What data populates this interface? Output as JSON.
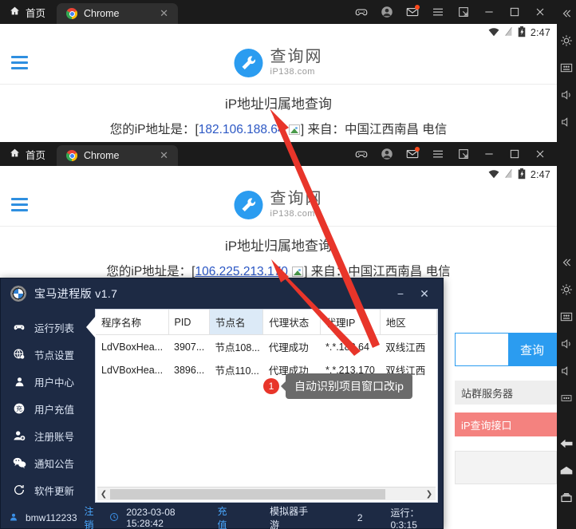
{
  "emulator": {
    "titlebar": {
      "home_label": "首页",
      "tab_label": "Chrome",
      "close_glyph": "✕",
      "icons": [
        "gamepad-icon",
        "account-icon",
        "mail-icon",
        "menu-icon",
        "resize-icon",
        "minimize-icon",
        "maximize-icon",
        "close-icon"
      ]
    },
    "statusbar": {
      "time": "2:47",
      "icons": [
        "wifi-icon",
        "signal-icon",
        "battery-icon"
      ]
    },
    "rail_icons": [
      "collapse-icon",
      "settings-icon",
      "keyboard-icon",
      "volume-up-icon",
      "volume-down-icon",
      "more-icon",
      "back-icon",
      "home-icon",
      "recents-icon"
    ]
  },
  "site": {
    "brand_cn": "查询网",
    "brand_en": "iP138.com",
    "page_title": "iP地址归属地查询",
    "ip_prefix": "您的iP地址是：[",
    "ip_suffix": "] 来自：",
    "location": "中国江西南昌 电信"
  },
  "windows": [
    {
      "ip": "182.106.188.64",
      "hovered": false
    },
    {
      "ip": "106.225.213.170",
      "hovered": true
    }
  ],
  "side_widgets": {
    "query_value": "",
    "query_placeholder": "",
    "query_button": "查询",
    "links": [
      {
        "label": "站群服务器",
        "hot": false
      },
      {
        "label": "iP查询接口",
        "hot": true
      }
    ]
  },
  "dialog": {
    "title": "宝马进程版 v1.7",
    "minimize_glyph": "−",
    "close_glyph": "✕",
    "nav": [
      {
        "label": "运行列表",
        "icon": "gamepad-icon",
        "active": true
      },
      {
        "label": "节点设置",
        "icon": "globe-icon",
        "active": false
      },
      {
        "label": "用户中心",
        "icon": "user-icon",
        "active": false
      },
      {
        "label": "用户充值",
        "icon": "recharge-icon",
        "active": false
      },
      {
        "label": "注册账号",
        "icon": "user-add-icon",
        "active": false
      },
      {
        "label": "通知公告",
        "icon": "wechat-icon",
        "active": false
      },
      {
        "label": "软件更新",
        "icon": "refresh-icon",
        "active": false
      }
    ],
    "table": {
      "columns": [
        {
          "label": "程序名称",
          "selected": false
        },
        {
          "label": "PID",
          "selected": false
        },
        {
          "label": "节点名",
          "selected": true
        },
        {
          "label": "代理状态",
          "selected": false
        },
        {
          "label": "代理IP",
          "selected": false
        },
        {
          "label": "地区",
          "selected": false
        }
      ],
      "rows": [
        [
          "LdVBoxHea...",
          "3907...",
          "节点108...",
          "代理成功",
          "*.*.188.64",
          "双线江西"
        ],
        [
          "LdVBoxHea...",
          "3896...",
          "节点110...",
          "代理成功",
          "*.*.213.170",
          "双线江西"
        ]
      ]
    },
    "statusbar": {
      "username": "bmw112233",
      "logout": "注销",
      "datetime": "2023-03-08 15:28:42",
      "recharge": "充值",
      "mode": "模拟器手游",
      "count": "2",
      "runtime": "运行：0:3:15"
    }
  },
  "annotation": {
    "badge": "1",
    "text": "自动识别项目窗口改ip",
    "arrow_color": "#e8352a"
  }
}
